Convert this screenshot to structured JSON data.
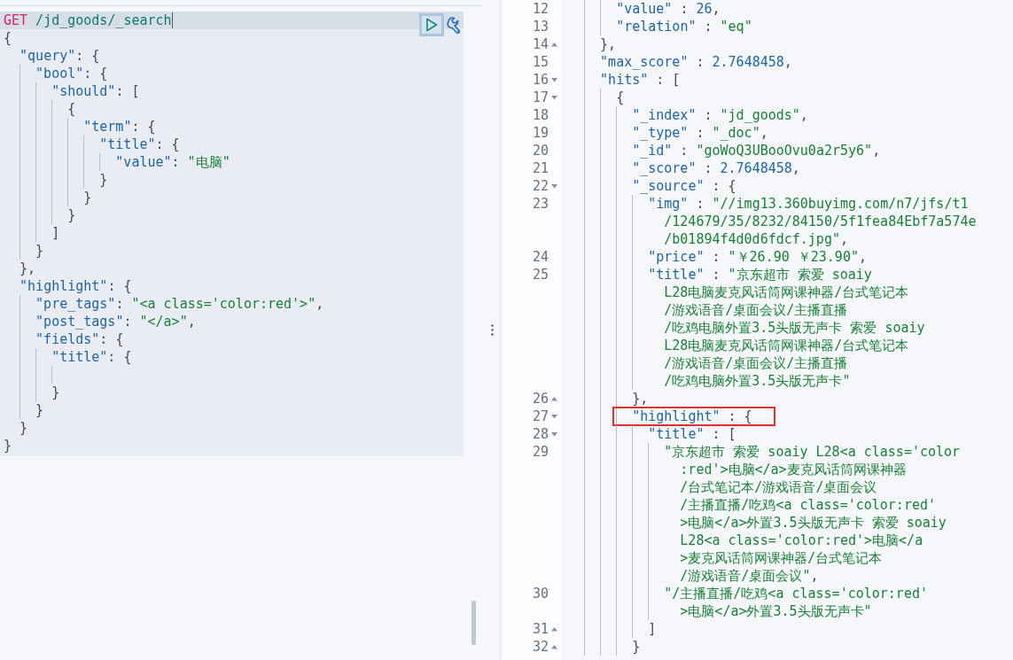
{
  "request": {
    "lines": [
      {
        "kind": "code",
        "cursor": true,
        "tokens": [
          {
            "kind": "method",
            "text": "GET"
          },
          {
            "kind": "path",
            "text": " /jd_goods/_search"
          }
        ]
      },
      {
        "kind": "code",
        "tokens": [
          {
            "kind": "punct",
            "text": "{"
          }
        ],
        "children": [
          {
            "kind": "code",
            "tokens": [
              {
                "kind": "key",
                "text": "\"query\""
              },
              {
                "kind": "punct",
                "text": ": {"
              }
            ],
            "children": [
              {
                "kind": "code",
                "tokens": [
                  {
                    "kind": "key",
                    "text": "\"bool\""
                  },
                  {
                    "kind": "punct",
                    "text": ": {"
                  }
                ],
                "children": [
                  {
                    "kind": "code",
                    "tokens": [
                      {
                        "kind": "key",
                        "text": "\"should\""
                      },
                      {
                        "kind": "punct",
                        "text": ": ["
                      }
                    ],
                    "children": [
                      {
                        "kind": "code",
                        "tokens": [
                          {
                            "kind": "punct",
                            "text": "{"
                          }
                        ],
                        "children": [
                          {
                            "kind": "code",
                            "tokens": [
                              {
                                "kind": "key",
                                "text": "\"term\""
                              },
                              {
                                "kind": "punct",
                                "text": ": {"
                              }
                            ],
                            "children": [
                              {
                                "kind": "code",
                                "tokens": [
                                  {
                                    "kind": "key",
                                    "text": "\"title\""
                                  },
                                  {
                                    "kind": "punct",
                                    "text": ": {"
                                  }
                                ],
                                "children": [
                                  {
                                    "kind": "code",
                                    "tokens": [
                                      {
                                        "kind": "key",
                                        "text": "\"value\""
                                      },
                                      {
                                        "kind": "punct",
                                        "text": ": "
                                      },
                                      {
                                        "kind": "string",
                                        "text": "\"电脑\""
                                      }
                                    ]
                                  }
                                ]
                              },
                              {
                                "kind": "code",
                                "tokens": [
                                  {
                                    "kind": "punct",
                                    "text": "}"
                                  }
                                ]
                              }
                            ]
                          },
                          {
                            "kind": "code",
                            "tokens": [
                              {
                                "kind": "punct",
                                "text": "}"
                              }
                            ]
                          }
                        ]
                      },
                      {
                        "kind": "code",
                        "tokens": [
                          {
                            "kind": "punct",
                            "text": "}"
                          }
                        ]
                      }
                    ]
                  },
                  {
                    "kind": "code",
                    "tokens": [
                      {
                        "kind": "punct",
                        "text": "]"
                      }
                    ]
                  }
                ]
              },
              {
                "kind": "code",
                "tokens": [
                  {
                    "kind": "punct",
                    "text": "}"
                  }
                ]
              }
            ]
          },
          {
            "kind": "code",
            "tokens": [
              {
                "kind": "punct",
                "text": "},"
              }
            ]
          },
          {
            "kind": "code",
            "tokens": [
              {
                "kind": "key",
                "text": "\"highlight\""
              },
              {
                "kind": "punct",
                "text": ": {"
              }
            ],
            "children": [
              {
                "kind": "code",
                "tokens": [
                  {
                    "kind": "key",
                    "text": "\"pre_tags\""
                  },
                  {
                    "kind": "punct",
                    "text": ": "
                  },
                  {
                    "kind": "string",
                    "text": "\"<a class='color:red'>\""
                  },
                  {
                    "kind": "punct",
                    "text": ","
                  }
                ]
              },
              {
                "kind": "code",
                "tokens": [
                  {
                    "kind": "key",
                    "text": "\"post_tags\""
                  },
                  {
                    "kind": "punct",
                    "text": ": "
                  },
                  {
                    "kind": "string",
                    "text": "\"</a>\""
                  },
                  {
                    "kind": "punct",
                    "text": ","
                  }
                ]
              },
              {
                "kind": "code",
                "tokens": [
                  {
                    "kind": "key",
                    "text": "\"fields\""
                  },
                  {
                    "kind": "punct",
                    "text": ": {"
                  }
                ],
                "children": [
                  {
                    "kind": "code",
                    "tokens": [
                      {
                        "kind": "key",
                        "text": "\"title\""
                      },
                      {
                        "kind": "punct",
                        "text": ": {"
                      }
                    ],
                    "children": [
                      {
                        "kind": "blank"
                      }
                    ]
                  },
                  {
                    "kind": "code",
                    "tokens": [
                      {
                        "kind": "punct",
                        "text": "}"
                      }
                    ]
                  }
                ]
              },
              {
                "kind": "code",
                "tokens": [
                  {
                    "kind": "punct",
                    "text": "}"
                  }
                ]
              }
            ]
          },
          {
            "kind": "code",
            "tokens": [
              {
                "kind": "punct",
                "text": "}"
              }
            ]
          }
        ]
      },
      {
        "kind": "code",
        "tokens": [
          {
            "kind": "punct",
            "text": "}"
          }
        ]
      }
    ]
  },
  "response": {
    "lines": [
      {
        "kind": "continued",
        "children": [
          {
            "kind": "code",
            "number": "12",
            "tokens": [
              {
                "kind": "key",
                "text": "\"value\""
              },
              {
                "kind": "punct",
                "text": " : "
              },
              {
                "kind": "number",
                "text": "26"
              },
              {
                "kind": "punct",
                "text": ","
              }
            ]
          },
          {
            "kind": "code",
            "number": "13",
            "tokens": [
              {
                "kind": "key",
                "text": "\"relation\""
              },
              {
                "kind": "punct",
                "text": " : "
              },
              {
                "kind": "string",
                "text": "\"eq\""
              }
            ]
          }
        ]
      },
      {
        "kind": "code",
        "number": "14",
        "fold_end": true,
        "tokens": [
          {
            "kind": "punct",
            "text": "},"
          }
        ]
      },
      {
        "kind": "code",
        "number": "15",
        "tokens": [
          {
            "kind": "key",
            "text": "\"max_score\""
          },
          {
            "kind": "punct",
            "text": " : "
          },
          {
            "kind": "number",
            "text": "2.7648458"
          },
          {
            "kind": "punct",
            "text": ","
          }
        ]
      },
      {
        "kind": "code",
        "number": "16",
        "expanded": true,
        "tokens": [
          {
            "kind": "key",
            "text": "\"hits\""
          },
          {
            "kind": "punct",
            "text": " : ["
          }
        ],
        "children": [
          {
            "kind": "code",
            "number": "17",
            "expanded": true,
            "tokens": [
              {
                "kind": "punct",
                "text": "{"
              }
            ],
            "children": [
              {
                "kind": "code",
                "number": "18",
                "tokens": [
                  {
                    "kind": "key",
                    "text": "\"_index\""
                  },
                  {
                    "kind": "punct",
                    "text": " : "
                  },
                  {
                    "kind": "string",
                    "text": "\"jd_goods\""
                  },
                  {
                    "kind": "punct",
                    "text": ","
                  }
                ]
              },
              {
                "kind": "code",
                "number": "19",
                "tokens": [
                  {
                    "kind": "key",
                    "text": "\"_type\""
                  },
                  {
                    "kind": "punct",
                    "text": " : "
                  },
                  {
                    "kind": "string",
                    "text": "\"_doc\""
                  },
                  {
                    "kind": "punct",
                    "text": ","
                  }
                ]
              },
              {
                "kind": "code",
                "number": "20",
                "tokens": [
                  {
                    "kind": "key",
                    "text": "\"_id\""
                  },
                  {
                    "kind": "punct",
                    "text": " : "
                  },
                  {
                    "kind": "string",
                    "text": "\"goWoQ3UBooOvu0a2r5y6\""
                  },
                  {
                    "kind": "punct",
                    "text": ","
                  }
                ]
              },
              {
                "kind": "code",
                "number": "21",
                "tokens": [
                  {
                    "kind": "key",
                    "text": "\"_score\""
                  },
                  {
                    "kind": "punct",
                    "text": " : "
                  },
                  {
                    "kind": "number",
                    "text": "2.7648458"
                  },
                  {
                    "kind": "punct",
                    "text": ","
                  }
                ]
              },
              {
                "kind": "code",
                "number": "22",
                "expanded": true,
                "tokens": [
                  {
                    "kind": "key",
                    "text": "\"_source\""
                  },
                  {
                    "kind": "punct",
                    "text": " : {"
                  }
                ],
                "children": [
                  {
                    "kind": "code",
                    "number": "23",
                    "tokens": [
                      {
                        "kind": "key",
                        "text": "\"img\""
                      },
                      {
                        "kind": "punct",
                        "text": " : "
                      },
                      {
                        "kind": "string",
                        "text": "\"//img13.360buyimg.com/n7/jfs/t1"
                      }
                    ],
                    "wrapped": [
                      {
                        "tokens": [
                          {
                            "kind": "string",
                            "text": "/124679/35/8232/84150/5f1fea84Ebf7a574e"
                          }
                        ]
                      },
                      {
                        "tokens": [
                          {
                            "kind": "string",
                            "text": "/b01894f4d0d6fdcf.jpg\""
                          },
                          {
                            "kind": "punct",
                            "text": ","
                          }
                        ]
                      }
                    ]
                  },
                  {
                    "kind": "code",
                    "number": "24",
                    "tokens": [
                      {
                        "kind": "key",
                        "text": "\"price\""
                      },
                      {
                        "kind": "punct",
                        "text": " : "
                      },
                      {
                        "kind": "string",
                        "text": "\"￥26.90 ￥23.90\""
                      },
                      {
                        "kind": "punct",
                        "text": ","
                      }
                    ]
                  },
                  {
                    "kind": "code",
                    "number": "25",
                    "tokens": [
                      {
                        "kind": "key",
                        "text": "\"title\""
                      },
                      {
                        "kind": "punct",
                        "text": " : "
                      },
                      {
                        "kind": "string",
                        "text": "\"京东超市 索爱 soaiy"
                      }
                    ],
                    "wrapped": [
                      {
                        "tokens": [
                          {
                            "kind": "string",
                            "text": "L28电脑麦克风话筒网课神器/台式笔记本"
                          }
                        ]
                      },
                      {
                        "tokens": [
                          {
                            "kind": "string",
                            "text": "/游戏语音/桌面会议/主播直播"
                          }
                        ]
                      },
                      {
                        "tokens": [
                          {
                            "kind": "string",
                            "text": "/吃鸡电脑外置3.5头版无声卡 索爱 soaiy"
                          }
                        ]
                      },
                      {
                        "tokens": [
                          {
                            "kind": "string",
                            "text": "L28电脑麦克风话筒网课神器/台式笔记本"
                          }
                        ]
                      },
                      {
                        "tokens": [
                          {
                            "kind": "string",
                            "text": "/游戏语音/桌面会议/主播直播"
                          }
                        ]
                      },
                      {
                        "tokens": [
                          {
                            "kind": "string",
                            "text": "/吃鸡电脑外置3.5头版无声卡\""
                          }
                        ]
                      }
                    ]
                  }
                ]
              },
              {
                "kind": "code",
                "number": "26",
                "fold_end": true,
                "tokens": [
                  {
                    "kind": "punct",
                    "text": "},"
                  }
                ]
              },
              {
                "kind": "code",
                "number": "27",
                "expanded": true,
                "boxed": true,
                "tokens": [
                  {
                    "kind": "key",
                    "text": "\"highlight\""
                  },
                  {
                    "kind": "punct",
                    "text": " : {"
                  }
                ],
                "children": [
                  {
                    "kind": "code",
                    "number": "28",
                    "expanded": true,
                    "tokens": [
                      {
                        "kind": "key",
                        "text": "\"title\""
                      },
                      {
                        "kind": "punct",
                        "text": " : ["
                      }
                    ],
                    "children": [
                      {
                        "kind": "code",
                        "number": "29",
                        "tokens": [
                          {
                            "kind": "string",
                            "text": "\"京东超市 索爱 soaiy L28<a class='color"
                          }
                        ],
                        "wrapped": [
                          {
                            "tokens": [
                              {
                                "kind": "string",
                                "text": ":red'>电脑</a>麦克风话筒网课神器"
                              }
                            ]
                          },
                          {
                            "tokens": [
                              {
                                "kind": "string",
                                "text": "/台式笔记本/游戏语音/桌面会议"
                              }
                            ]
                          },
                          {
                            "tokens": [
                              {
                                "kind": "string",
                                "text": "/主播直播/吃鸡<a class='color:red'"
                              }
                            ]
                          },
                          {
                            "tokens": [
                              {
                                "kind": "string",
                                "text": ">电脑</a>外置3.5头版无声卡 索爱 soaiy"
                              }
                            ]
                          },
                          {
                            "tokens": [
                              {
                                "kind": "string",
                                "text": "L28<a class='color:red'>电脑</a"
                              }
                            ]
                          },
                          {
                            "tokens": [
                              {
                                "kind": "string",
                                "text": ">麦克风话筒网课神器/台式笔记本"
                              }
                            ]
                          },
                          {
                            "tokens": [
                              {
                                "kind": "string",
                                "text": "/游戏语音/桌面会议\""
                              },
                              {
                                "kind": "punct",
                                "text": ","
                              }
                            ]
                          }
                        ]
                      },
                      {
                        "kind": "code",
                        "number": "30",
                        "tokens": [
                          {
                            "kind": "string",
                            "text": "\"/主播直播/吃鸡<a class='color:red'"
                          }
                        ],
                        "wrapped": [
                          {
                            "tokens": [
                              {
                                "kind": "string",
                                "text": ">电脑</a>外置3.5头版无声卡\""
                              }
                            ]
                          }
                        ]
                      }
                    ]
                  },
                  {
                    "kind": "code",
                    "number": "31",
                    "fold_end": true,
                    "tokens": [
                      {
                        "kind": "punct",
                        "text": "]"
                      }
                    ]
                  }
                ]
              },
              {
                "kind": "code",
                "number": "32",
                "fold_end": true,
                "tokens": [
                  {
                    "kind": "punct",
                    "text": "}"
                  }
                ]
              }
            ]
          }
        ]
      }
    ]
  }
}
